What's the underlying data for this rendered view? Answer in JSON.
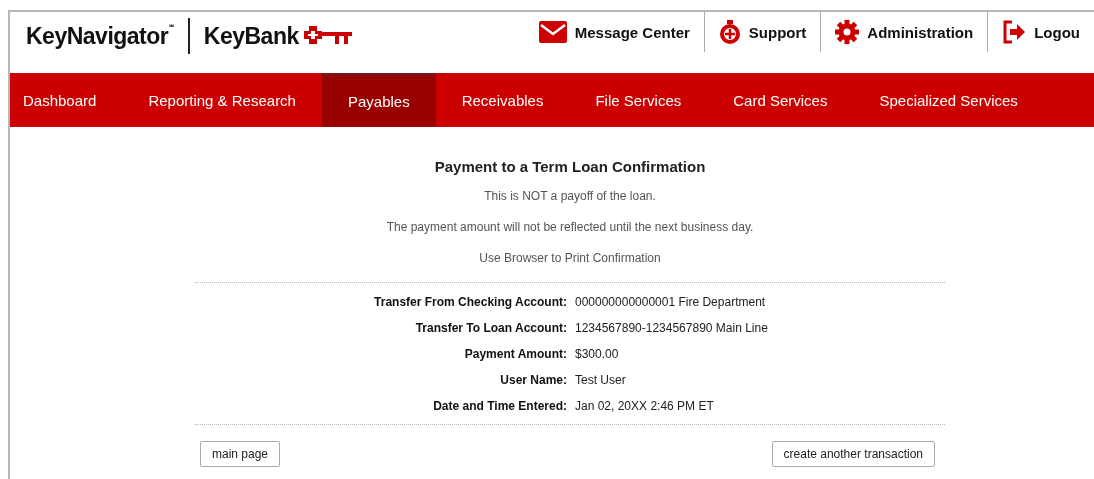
{
  "brand": {
    "product": "KeyNavigator",
    "product_mark": "℠",
    "bank": "KeyBank"
  },
  "top_links": [
    {
      "kind": "mail",
      "label": "Message Center"
    },
    {
      "kind": "support",
      "label": "Support"
    },
    {
      "kind": "gear",
      "label": "Administration"
    },
    {
      "kind": "logout",
      "label": "Logou"
    }
  ],
  "nav": [
    {
      "label": "Dashboard",
      "selected": false
    },
    {
      "label": "Reporting & Research",
      "selected": false
    },
    {
      "label": "Payables",
      "selected": true
    },
    {
      "label": "Receivables",
      "selected": false
    },
    {
      "label": "File Services",
      "selected": false
    },
    {
      "label": "Card Services",
      "selected": false
    },
    {
      "label": "Specialized Services",
      "selected": false
    }
  ],
  "title": "Payment to a Term Loan Confirmation",
  "notes": [
    "This is NOT a payoff of the loan.",
    "The payment amount will not be reflected until the next business day.",
    "Use Browser to Print Confirmation"
  ],
  "details": [
    {
      "label": "Transfer From Checking Account:",
      "value": "000000000000001 Fire Department"
    },
    {
      "label": "Transfer To Loan Account:",
      "value": "1234567890-1234567890 Main Line"
    },
    {
      "label": "Payment Amount:",
      "value": "$300.00"
    },
    {
      "label": "User Name:",
      "value": "Test User"
    },
    {
      "label": "Date and Time Entered:",
      "value": "Jan 02, 20XX 2:46 PM ET"
    }
  ],
  "buttons": [
    "main page",
    "create another transaction"
  ]
}
